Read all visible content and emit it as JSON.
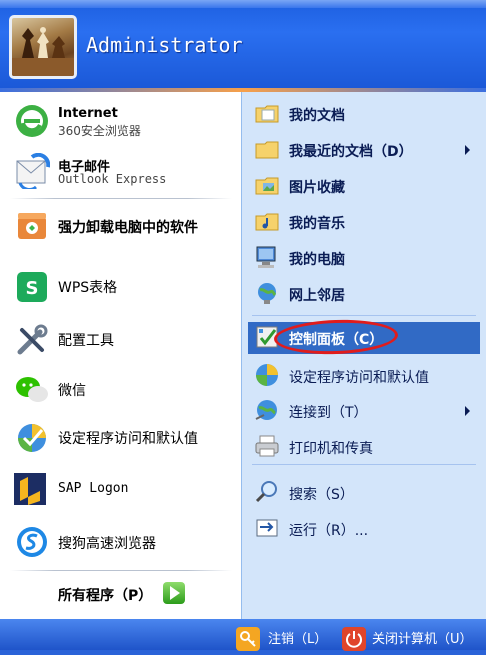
{
  "header": {
    "username": "Administrator"
  },
  "left_pinned": [
    {
      "name": "Internet",
      "sub": "360安全浏览器"
    },
    {
      "name": "电子邮件",
      "sub": "Outlook Express"
    }
  ],
  "left_recent": [
    {
      "label": "强力卸载电脑中的软件"
    },
    {
      "label": "WPS表格"
    },
    {
      "label": "配置工具"
    },
    {
      "label": "微信"
    },
    {
      "label": "设定程序访问和默认值"
    },
    {
      "label": "SAP Logon"
    },
    {
      "label": "搜狗高速浏览器"
    }
  ],
  "all_programs": "所有程序（P）",
  "right_items": [
    {
      "label": "我的文档"
    },
    {
      "label": "我最近的文档（D）"
    },
    {
      "label": "图片收藏"
    },
    {
      "label": "我的音乐"
    },
    {
      "label": "我的电脑"
    },
    {
      "label": "网上邻居"
    },
    {
      "label": "控制面板（C）"
    },
    {
      "label": "设定程序访问和默认值"
    },
    {
      "label": "连接到（T）"
    },
    {
      "label": "打印机和传真"
    },
    {
      "label": "搜索（S）"
    },
    {
      "label": "运行（R）..."
    }
  ],
  "footer": {
    "logoff": "注销（L）",
    "shutdown": "关闭计算机（U）"
  },
  "colors": {
    "header_blue": "#2a6ff0",
    "right_pane": "#d3e5fa",
    "highlight": "#316ac5",
    "annotation_red": "#e01c1c"
  }
}
